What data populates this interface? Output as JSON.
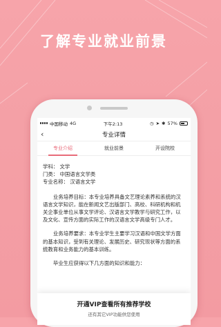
{
  "headline": "了解专业就业前景",
  "status_bar": {
    "carrier": "中国移动",
    "network": "4G",
    "time": "下午2:13",
    "battery": "57%",
    "battery_level": 0.57
  },
  "nav": {
    "title": "专业详情"
  },
  "tabs": [
    "专业介绍",
    "就业前景",
    "开设院校"
  ],
  "info": {
    "subject": "学科：  文学",
    "category": "门类：  中国语言文学类",
    "major": "专业名称：  汉语言文学"
  },
  "paragraphs": [
    "业务培养目标：本专业培养具备文艺理论素养和系统的汉语言文学知识，能在新闻文艺出版部门、高校、科研机构和机关企事业单位从事文学评论、汉语言文学教学与研究工作，以及文化、宣传方面的实际工作的汉语言文学高级专门人才。",
    "业务培养要求：本专业学生主要学习汉语和中国文学方面的基本知识，受到有关理论、发展历史、研究现状等方面的系统教育和业务能力的基本训练。",
    "毕业生应获得以下几方面的知识和能力："
  ],
  "banner": {
    "title": "开通VIP查看所有推荐学校",
    "subtitle": "还有其它VIP功能供您使用"
  }
}
